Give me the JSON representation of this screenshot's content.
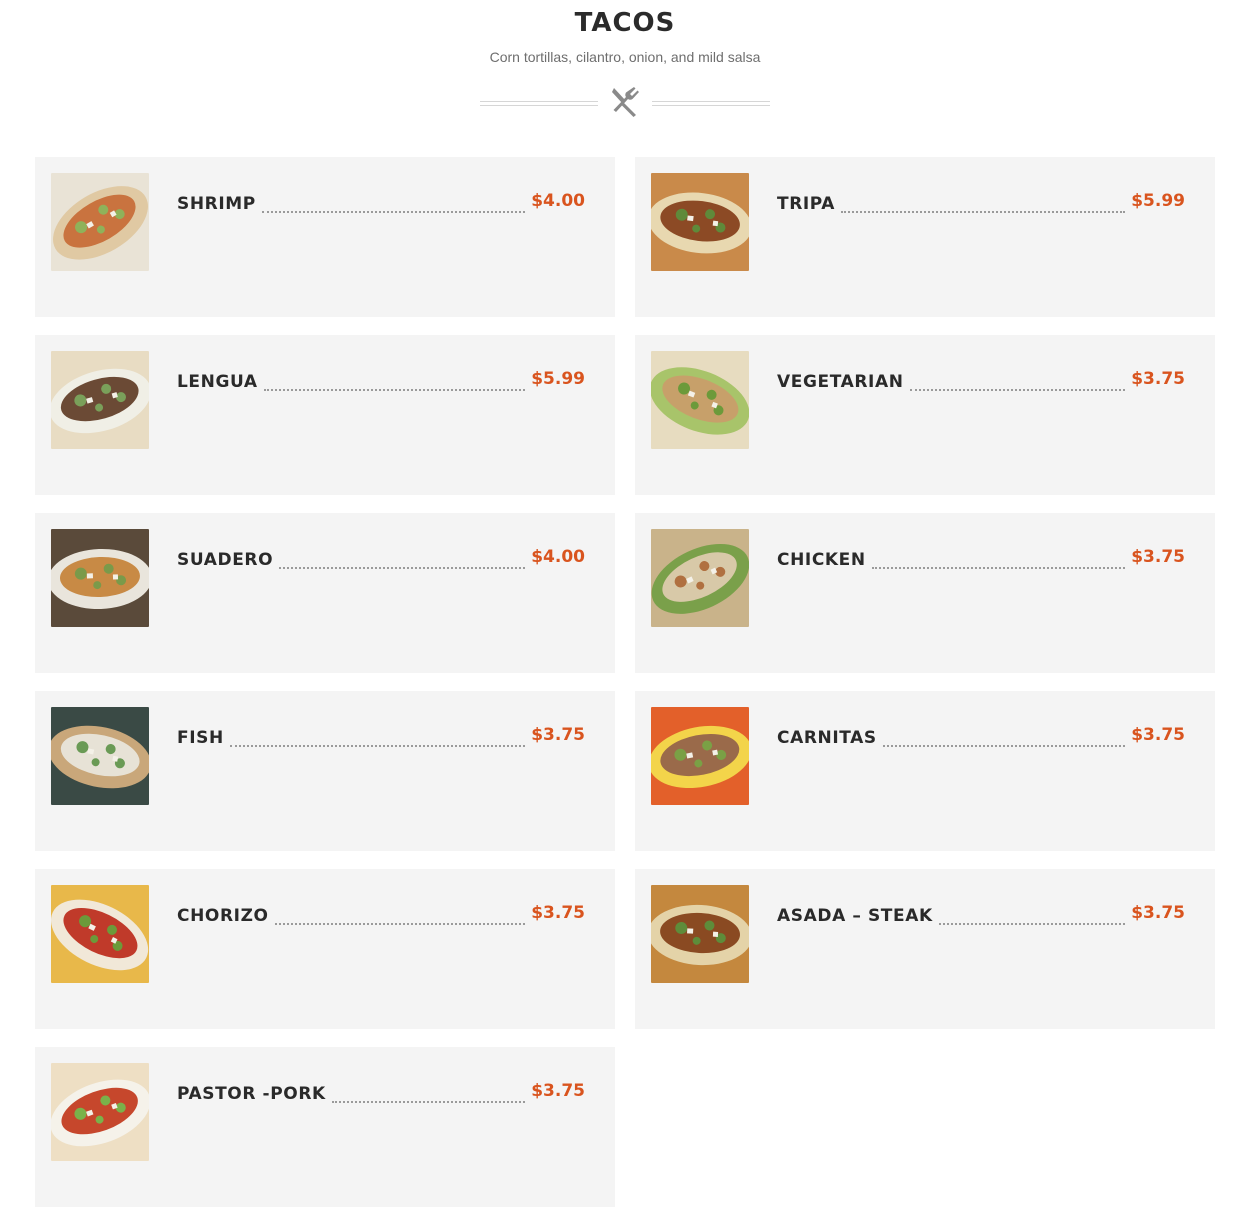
{
  "section": {
    "title": "TACOS",
    "subtitle": "Corn tortillas, cilantro, onion, and mild salsa",
    "divider_icon": "fork-knife-icon"
  },
  "colors": {
    "price": "#d9541e",
    "card_bg": "#f4f4f4",
    "name": "#2a2a2a"
  },
  "items": [
    {
      "name": "SHRIMP",
      "price": "$4.00"
    },
    {
      "name": "TRIPA",
      "price": "$5.99"
    },
    {
      "name": "LENGUA",
      "price": "$5.99"
    },
    {
      "name": "VEGETARIAN",
      "price": "$3.75"
    },
    {
      "name": "SUADERO",
      "price": "$4.00"
    },
    {
      "name": "CHICKEN",
      "price": "$3.75"
    },
    {
      "name": "FISH",
      "price": "$3.75"
    },
    {
      "name": "CARNITAS",
      "price": "$3.75"
    },
    {
      "name": "CHORIZO",
      "price": "$3.75"
    },
    {
      "name": "ASADA – STEAK",
      "price": "$3.75"
    },
    {
      "name": "PASTOR -PORK",
      "price": "$3.75"
    }
  ]
}
